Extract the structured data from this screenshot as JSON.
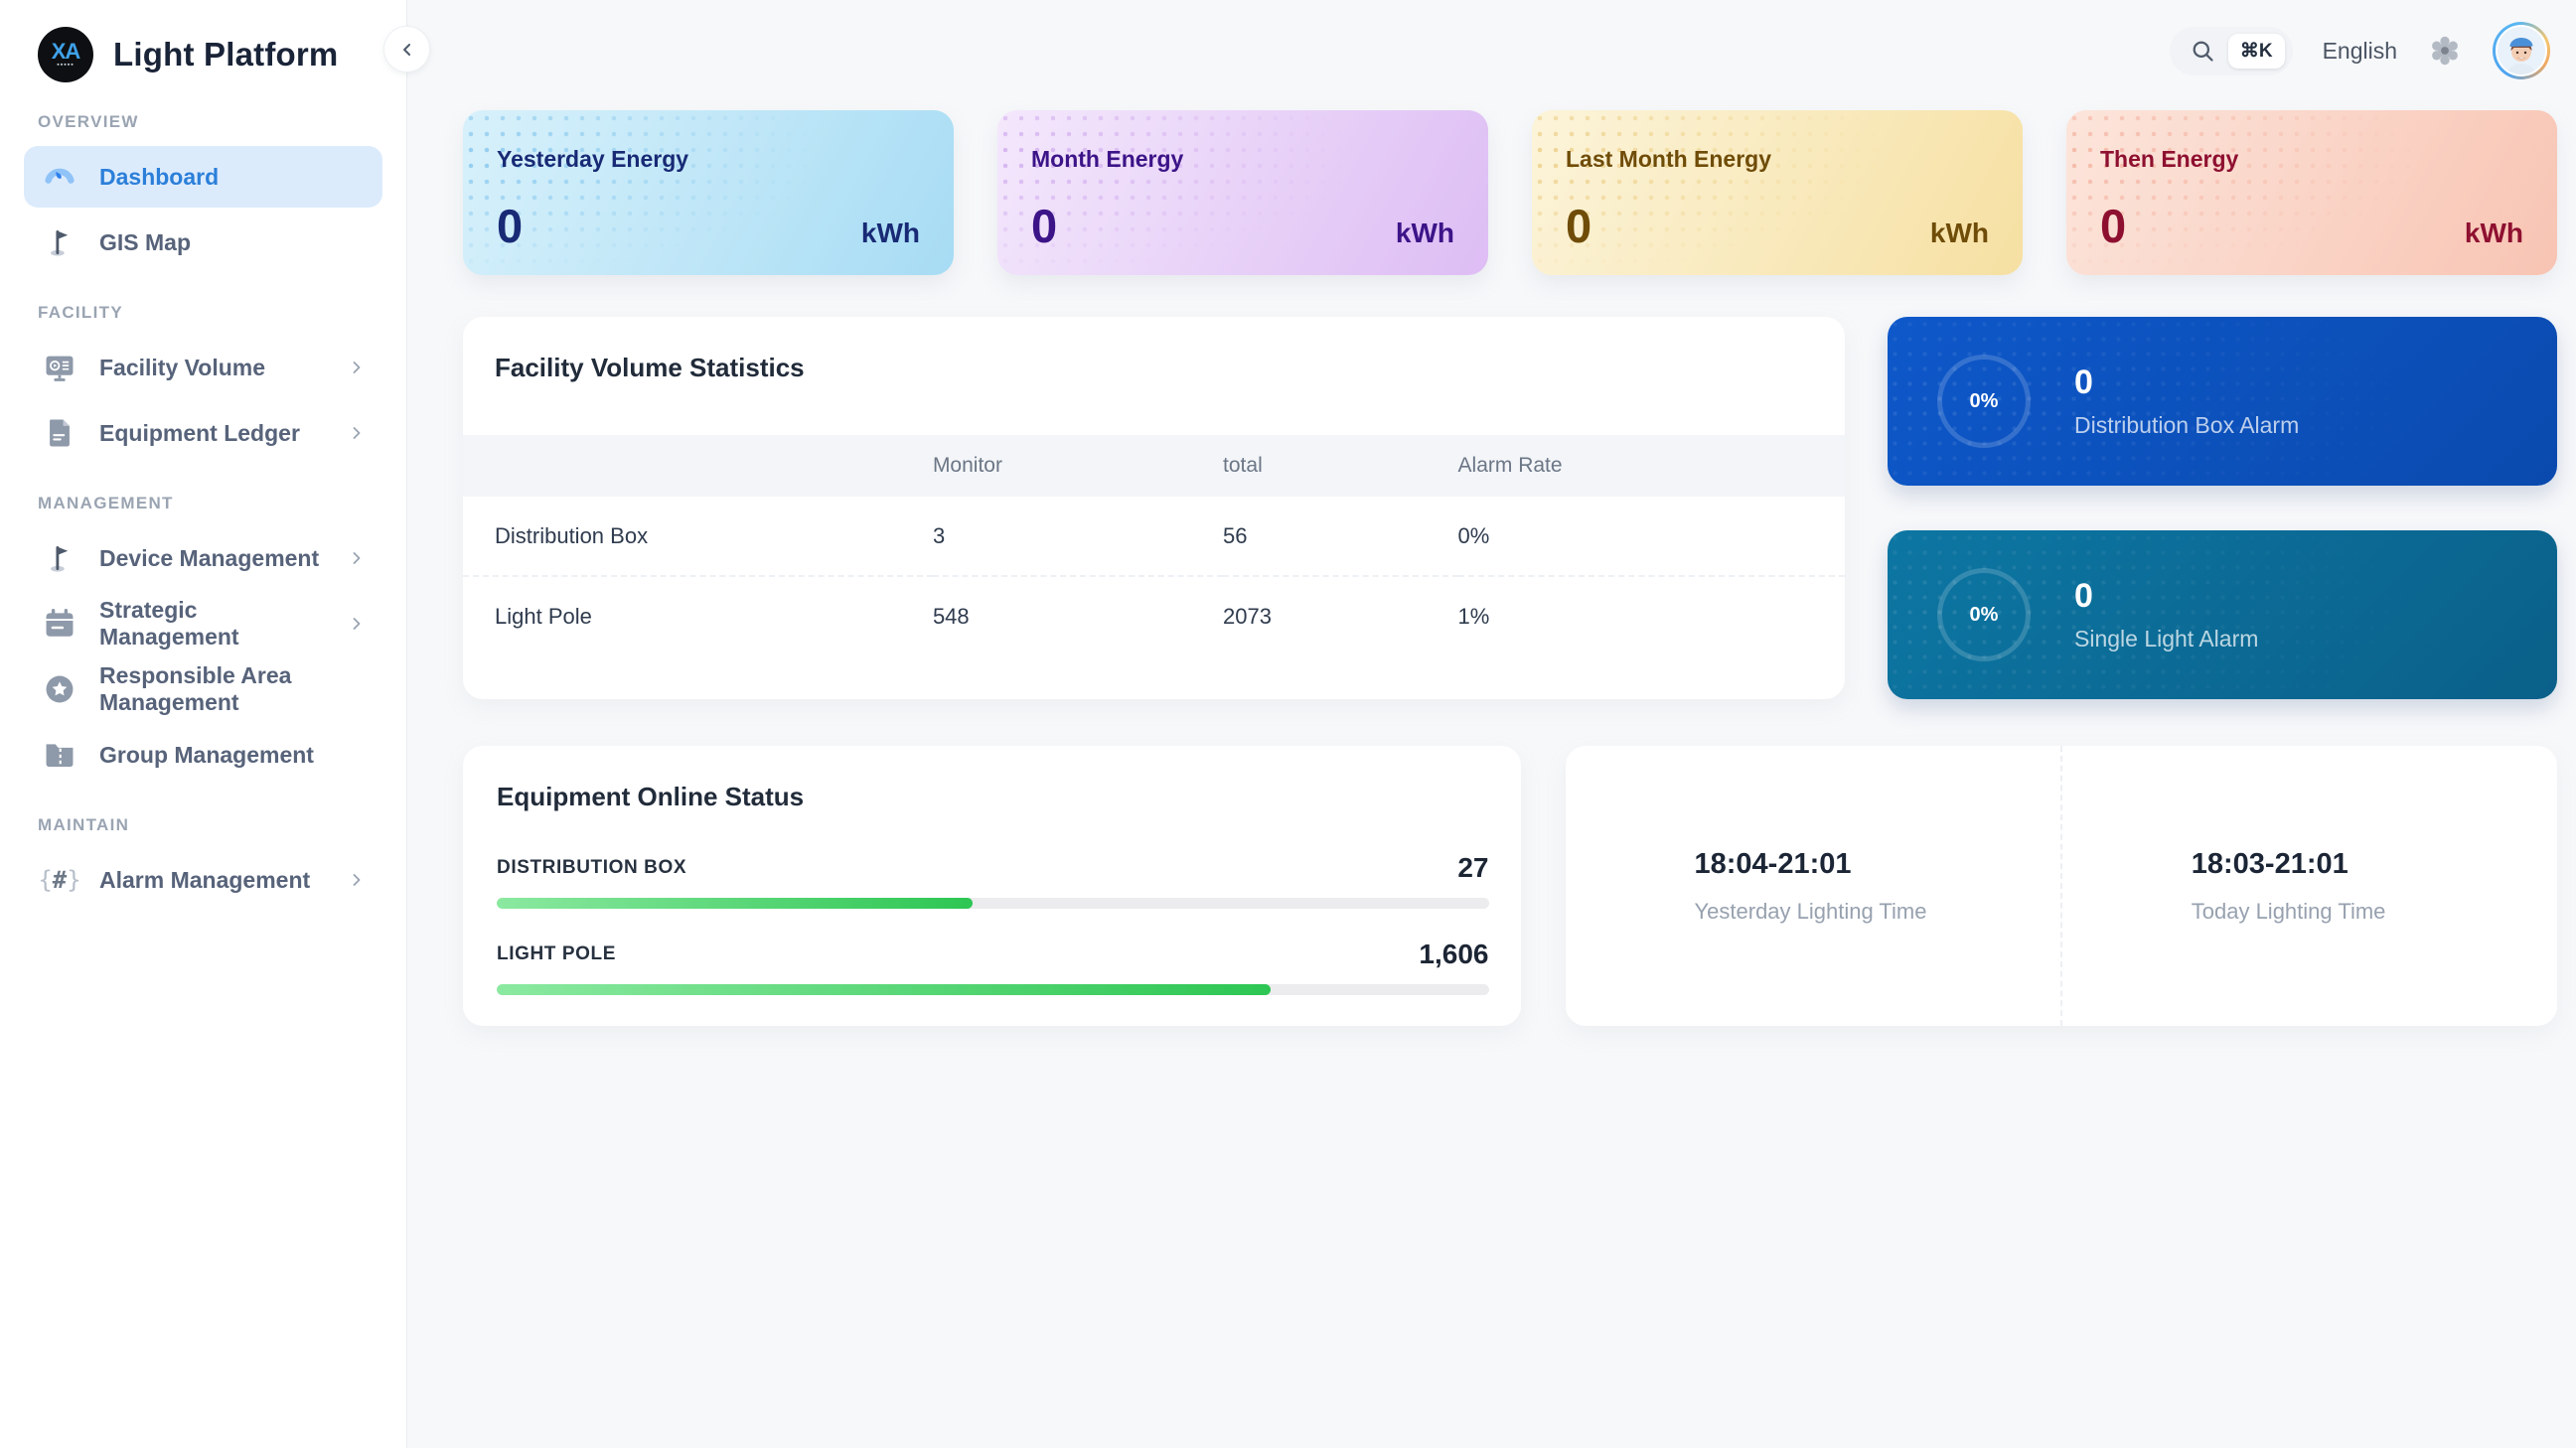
{
  "app": {
    "title": "Light Platform",
    "logo_monogram": "XA"
  },
  "header": {
    "search_shortcut": "⌘K",
    "language": "English"
  },
  "sidebar": {
    "sections": [
      {
        "label": "OVERVIEW",
        "items": [
          {
            "label": "Dashboard"
          },
          {
            "label": "GIS Map"
          }
        ]
      },
      {
        "label": "FACILITY",
        "items": [
          {
            "label": "Facility Volume"
          },
          {
            "label": "Equipment Ledger"
          }
        ]
      },
      {
        "label": "MANAGEMENT",
        "items": [
          {
            "label": "Device Management"
          },
          {
            "label": "Strategic Management"
          },
          {
            "label": "Responsible Area Management"
          },
          {
            "label": "Group Management"
          }
        ]
      },
      {
        "label": "MAINTAIN",
        "items": [
          {
            "label": "Alarm Management"
          }
        ]
      }
    ]
  },
  "energy_cards": [
    {
      "title": "Yesterday Energy",
      "value": "0",
      "unit": "kWh",
      "accent": "#182a75"
    },
    {
      "title": "Month Energy",
      "value": "0",
      "unit": "kWh",
      "accent": "#3c1488"
    },
    {
      "title": "Last Month Energy",
      "value": "0",
      "unit": "kWh",
      "accent": "#6f4c08"
    },
    {
      "title": "Then Energy",
      "value": "0",
      "unit": "kWh",
      "accent": "#8e1030"
    }
  ],
  "facility_statistics": {
    "title": "Facility Volume Statistics",
    "columns": {
      "monitor": "Monitor",
      "total": "total",
      "alarm_rate": "Alarm Rate"
    },
    "rows": [
      {
        "name": "Distribution Box",
        "monitor": "3",
        "total": "56",
        "alarm_rate": "0%"
      },
      {
        "name": "Light Pole",
        "monitor": "548",
        "total": "2073",
        "alarm_rate": "1%"
      }
    ]
  },
  "alarm_cards": [
    {
      "percent": "0%",
      "value": "0",
      "label": "Distribution Box Alarm",
      "color": "#0b52bf"
    },
    {
      "percent": "0%",
      "value": "0",
      "label": "Single Light Alarm",
      "color": "#0c6d96"
    }
  ],
  "online_status": {
    "title": "Equipment Online Status",
    "bar_color": "#2dc653",
    "items": [
      {
        "label": "DISTRIBUTION BOX",
        "value": "27",
        "percent": 48
      },
      {
        "label": "LIGHT POLE",
        "value": "1,606",
        "percent": 78
      }
    ]
  },
  "lighting_times": [
    {
      "time": "18:04-21:01",
      "label": "Yesterday Lighting Time"
    },
    {
      "time": "18:03-21:01",
      "label": "Today Lighting Time"
    }
  ]
}
